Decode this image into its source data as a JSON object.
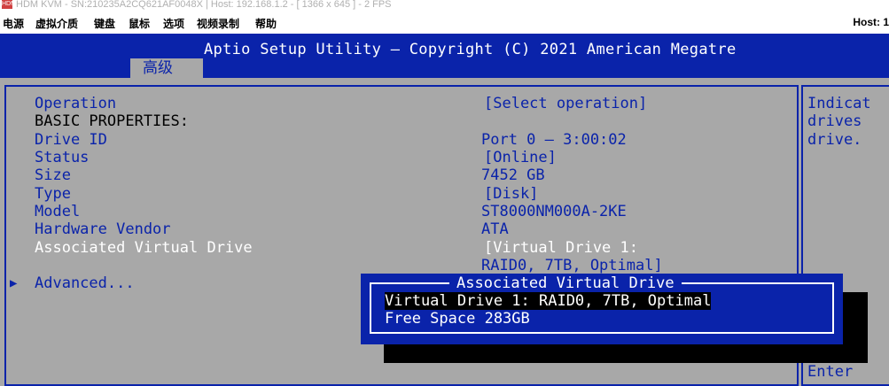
{
  "window": {
    "title": "HDM KVM - SN:210235A2CQ621AF0048X | Host: 192.168.1.2 - [ 1366 x 645 ] - 2 FPS",
    "icon_name": "hdm-app-icon"
  },
  "menubar": {
    "items": [
      "电源",
      "虚拟介质",
      "键盘",
      "鼠标",
      "选项",
      "视频录制",
      "帮助"
    ],
    "host_label": "Host: 1"
  },
  "bios": {
    "title": "Aptio Setup Utility – Copyright (C) 2021 American Megatre",
    "active_tab": "高级",
    "rows": [
      {
        "label": "Operation",
        "value": "[Select operation]",
        "label_color": "blue",
        "value_color": "blue"
      },
      {
        "label": "BASIC PROPERTIES:",
        "value": "",
        "label_color": "black",
        "value_color": "blue"
      },
      {
        "label": "Drive ID",
        "value": "Port 0 – 3:00:02",
        "label_color": "blue",
        "value_color": "blue"
      },
      {
        "label": "Status",
        "value": "[Online]",
        "label_color": "blue",
        "value_color": "blue"
      },
      {
        "label": "Size",
        "value": "7452 GB",
        "label_color": "blue",
        "value_color": "blue"
      },
      {
        "label": "Type",
        "value": "[Disk]",
        "label_color": "blue",
        "value_color": "blue"
      },
      {
        "label": "Model",
        "value": "ST8000NM000A-2KE",
        "label_color": "blue",
        "value_color": "blue"
      },
      {
        "label": "Hardware Vendor",
        "value": "ATA",
        "label_color": "blue",
        "value_color": "blue"
      },
      {
        "label": "Associated Virtual Drive",
        "value": "[Virtual Drive 1:",
        "label_color": "white",
        "value_color": "white"
      },
      {
        "label": "",
        "value": "RAID0, 7TB, Optimal]",
        "label_color": "blue",
        "value_color": "blue"
      },
      {
        "label": "Advanced...",
        "value": "",
        "label_color": "blue",
        "value_color": "blue"
      }
    ],
    "help_lines": [
      "Indicat",
      "drives",
      "drive.",
      "Enter"
    ],
    "popup": {
      "title": "Associated Virtual Drive",
      "options": [
        "Virtual Drive 1: RAID0, 7TB, Optimal",
        "Free Space 283GB"
      ],
      "selected_index": 0
    },
    "colors": {
      "header_bg": "#0a23aa",
      "body_bg": "#a8a8a8",
      "text_blue": "#0a23aa",
      "highlight": "#ffffff"
    }
  }
}
